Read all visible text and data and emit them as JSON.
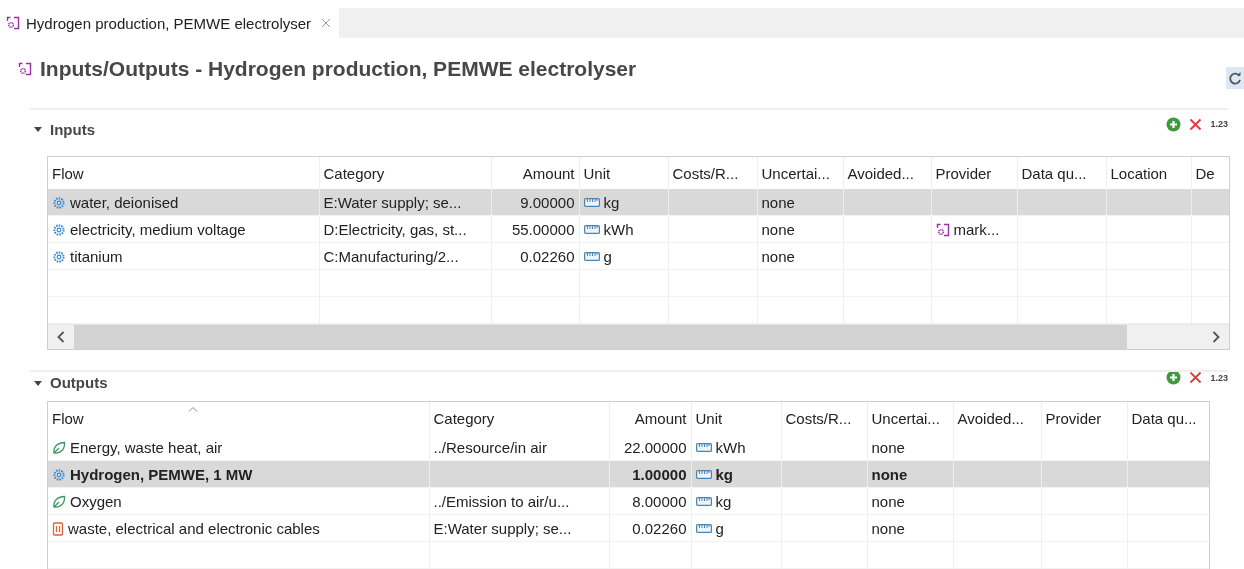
{
  "tab": {
    "label": "Hydrogen production, PEMWE electrolyser",
    "selected": true
  },
  "title": "Inputs/Outputs - Hydrogen production, PEMWE electrolyser",
  "sections": [
    {
      "title": "Inputs",
      "expanded": true,
      "number_format": "1.23",
      "columns": [
        {
          "label": "Flow",
          "sorted": false
        },
        {
          "label": "Category",
          "sorted": false
        },
        {
          "label": "Amount",
          "sorted": false
        },
        {
          "label": "Unit",
          "sorted": false
        },
        {
          "label": "Costs/R...",
          "sorted": false
        },
        {
          "label": "Uncertai...",
          "sorted": false
        },
        {
          "label": "Avoided...",
          "sorted": false
        },
        {
          "label": "Provider",
          "sorted": false
        },
        {
          "label": "Data qu...",
          "sorted": false
        },
        {
          "label": "Location",
          "sorted": false
        },
        {
          "label": "De",
          "sorted": false
        }
      ],
      "rows": [
        {
          "kind": "product",
          "flow": "water, deionised",
          "category": "E:Water supply; se...",
          "amount": "9.00000",
          "unit": "kg",
          "uncertainty": "none",
          "selected": true,
          "reference": false
        },
        {
          "kind": "product",
          "flow": "electricity, medium voltage",
          "category": "D:Electricity, gas, st...",
          "amount": "55.00000",
          "unit": "kWh",
          "uncertainty": "none",
          "provider": "mark...",
          "selected": false,
          "reference": false
        },
        {
          "kind": "product",
          "flow": "titanium",
          "category": "C:Manufacturing/2...",
          "amount": "0.02260",
          "unit": "g",
          "uncertainty": "none",
          "selected": false,
          "reference": false
        }
      ]
    },
    {
      "title": "Outputs",
      "expanded": true,
      "number_format": "1.23",
      "columns": [
        {
          "label": "Flow",
          "sorted": true
        },
        {
          "label": "Category",
          "sorted": false
        },
        {
          "label": "Amount",
          "sorted": false
        },
        {
          "label": "Unit",
          "sorted": false
        },
        {
          "label": "Costs/R...",
          "sorted": false
        },
        {
          "label": "Uncertai...",
          "sorted": false
        },
        {
          "label": "Avoided...",
          "sorted": false
        },
        {
          "label": "Provider",
          "sorted": false
        },
        {
          "label": "Data qu...",
          "sorted": false
        }
      ],
      "rows": [
        {
          "kind": "elementary",
          "flow": "Energy, waste heat, air",
          "category": "../Resource/in air",
          "amount": "22.00000",
          "unit": "kWh",
          "uncertainty": "none",
          "selected": false,
          "reference": false
        },
        {
          "kind": "product",
          "flow": "Hydrogen, PEMWE, 1 MW",
          "amount": "1.00000",
          "unit": "kg",
          "uncertainty": "none",
          "selected": true,
          "reference": true
        },
        {
          "kind": "elementary",
          "flow": "Oxygen",
          "category": "../Emission to air/u...",
          "amount": "8.00000",
          "unit": "kg",
          "uncertainty": "none",
          "selected": false,
          "reference": false
        },
        {
          "kind": "waste",
          "flow": "waste, electrical and electronic cables",
          "category": "E:Water supply; se...",
          "amount": "0.02260",
          "unit": "g",
          "uncertainty": "none",
          "selected": false,
          "reference": false
        }
      ]
    }
  ]
}
